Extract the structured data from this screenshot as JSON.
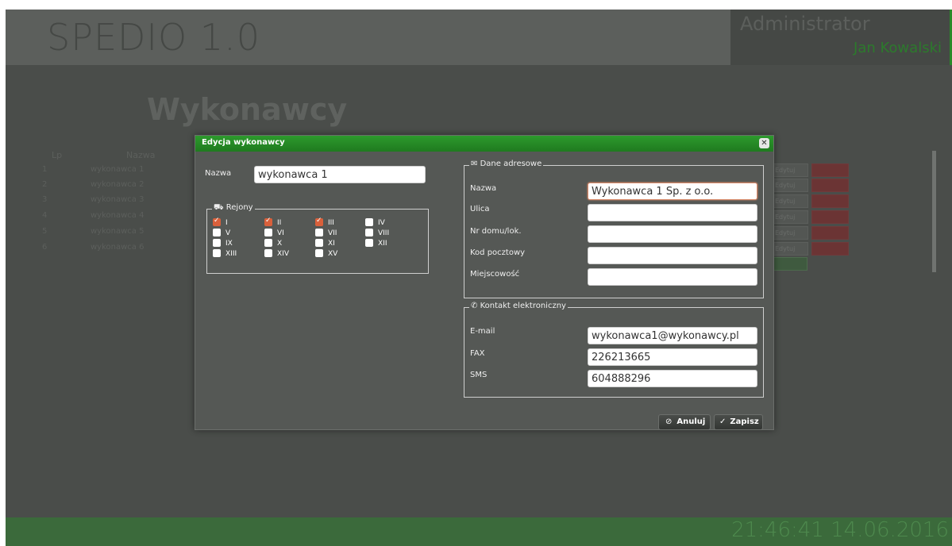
{
  "header": {
    "app_title": "SPEDIO 1.0",
    "role": "Administrator",
    "user_name": "Jan Kowalski"
  },
  "page": {
    "title": "Wykonawcy",
    "columns": [
      "Lp",
      "Nazwa"
    ],
    "rows": [
      {
        "lp": "1",
        "name": "wykonawca 1"
      },
      {
        "lp": "2",
        "name": "wykonawca 2"
      },
      {
        "lp": "3",
        "name": "wykonawca 3"
      },
      {
        "lp": "4",
        "name": "wykonawca 4"
      },
      {
        "lp": "5",
        "name": "wykonawca 5"
      },
      {
        "lp": "6",
        "name": "wykonawca 6"
      }
    ],
    "edit_label": "Edytuj"
  },
  "modal": {
    "title": "Edycja wykonawcy",
    "name_label": "Nazwa",
    "name_value": "wykonawca 1",
    "regions": {
      "legend": "Rejony",
      "items": [
        {
          "label": "I",
          "checked": true
        },
        {
          "label": "II",
          "checked": true
        },
        {
          "label": "III",
          "checked": true
        },
        {
          "label": "IV",
          "checked": false
        },
        {
          "label": "V",
          "checked": false
        },
        {
          "label": "VI",
          "checked": false
        },
        {
          "label": "VII",
          "checked": false
        },
        {
          "label": "VIII",
          "checked": false
        },
        {
          "label": "IX",
          "checked": false
        },
        {
          "label": "X",
          "checked": false
        },
        {
          "label": "XI",
          "checked": false
        },
        {
          "label": "XII",
          "checked": false
        },
        {
          "label": "XIII",
          "checked": false
        },
        {
          "label": "XIV",
          "checked": false
        },
        {
          "label": "XV",
          "checked": false
        }
      ]
    },
    "address": {
      "legend": "Dane adresowe",
      "fields": [
        {
          "label": "Nazwa",
          "value": "Wykonawca 1 Sp. z o.o."
        },
        {
          "label": "Ulica",
          "value": ""
        },
        {
          "label": "Nr domu/lok.",
          "value": ""
        },
        {
          "label": "Kod pocztowy",
          "value": ""
        },
        {
          "label": "Miejscowość",
          "value": ""
        }
      ]
    },
    "contact": {
      "legend": "Kontakt elektroniczny",
      "fields": [
        {
          "label": "E-mail",
          "value": "wykonawca1@wykonawcy.pl"
        },
        {
          "label": "FAX",
          "value": "226213665"
        },
        {
          "label": "SMS",
          "value": "604888296"
        }
      ]
    },
    "cancel_label": "Anuluj",
    "save_label": "Zapisz"
  },
  "footer": {
    "time": "21:46:41",
    "date": "14.06.2016"
  },
  "colors": {
    "accent": "#2d9a2d",
    "checkbox_checked": "#d9603b",
    "background": "#4a4d4a"
  }
}
